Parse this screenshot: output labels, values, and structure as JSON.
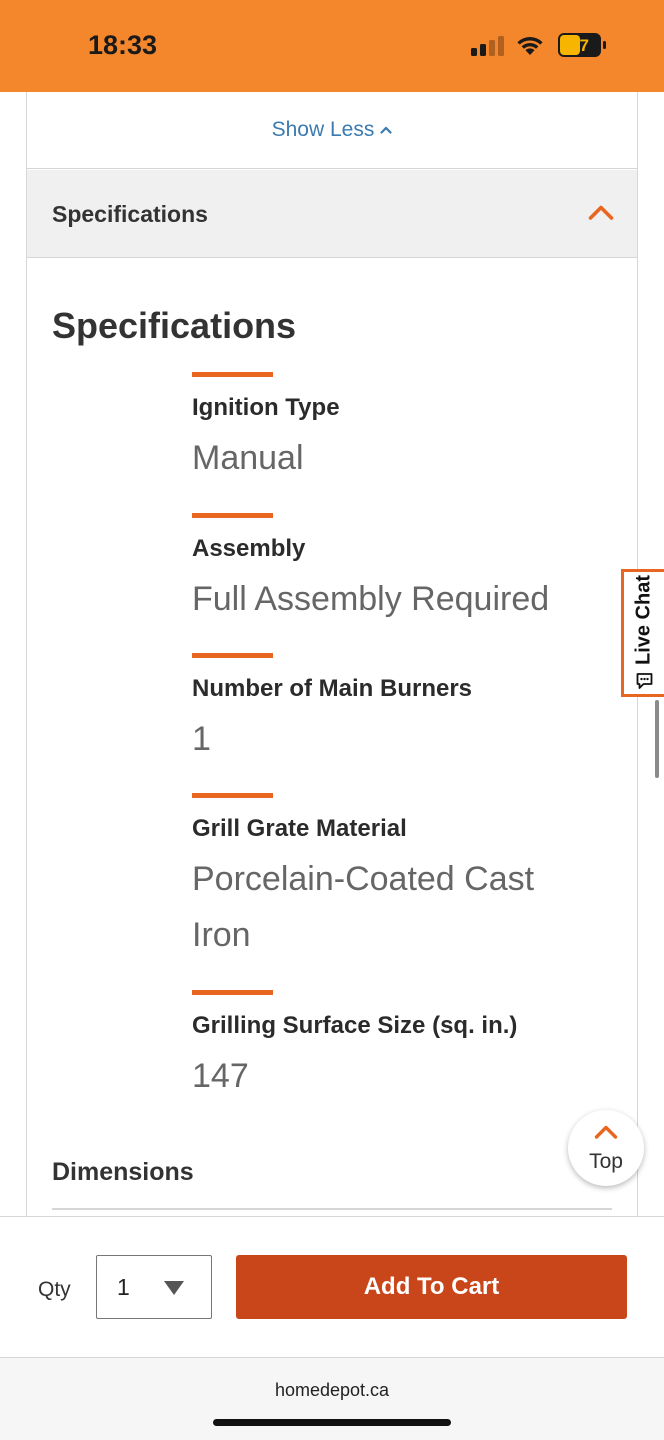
{
  "status_bar": {
    "time": "18:33",
    "battery": "47",
    "icons": [
      "signal-icon",
      "wifi-icon",
      "battery-icon"
    ]
  },
  "colors": {
    "accent": "#f96302",
    "status_bar": "#f4862b",
    "button": "#c9461a",
    "link": "#3b7bb0"
  },
  "content": {
    "show_less": "Show Less",
    "spec_section_header": "Specifications",
    "spec_title": "Specifications",
    "specs": [
      {
        "label": "Ignition Type",
        "value": "Manual"
      },
      {
        "label": "Assembly",
        "value": "Full Assembly Required"
      },
      {
        "label": "Number of Main Burners",
        "value": "1"
      },
      {
        "label": "Grill Grate Material",
        "value": "Porcelain-Coated Cast Iron"
      },
      {
        "label": "Grilling Surface Size (sq. in.)",
        "value": "147"
      }
    ],
    "dimensions_label": "Dimensions"
  },
  "live_chat": {
    "label": "Live Chat"
  },
  "top_button": {
    "label": "Top"
  },
  "cart": {
    "qty_label": "Qty",
    "qty_value": "1",
    "add_to_cart": "Add To Cart"
  },
  "browser": {
    "url": "homedepot.ca"
  }
}
